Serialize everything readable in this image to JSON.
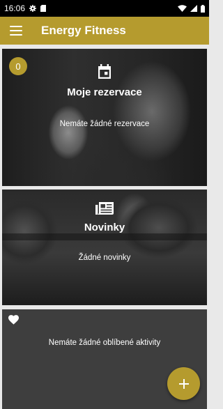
{
  "status_bar": {
    "time": "16:06",
    "left_icons": [
      "settings-icon",
      "sim-card-icon"
    ],
    "right_icons": [
      "wifi-icon",
      "cell-signal-icon",
      "battery-icon"
    ]
  },
  "app_bar": {
    "title": "Energy Fitness",
    "menu_icon": "hamburger-menu-icon",
    "color": "#b59b2e"
  },
  "cards": {
    "reservations": {
      "badge_count": "0",
      "icon": "calendar-icon",
      "title": "Moje rezervace",
      "subtitle": "Nemáte žádné rezervace"
    },
    "news": {
      "icon": "newspaper-icon",
      "title": "Novinky",
      "subtitle": "Žádné novinky"
    },
    "favorites": {
      "icon": "heart-icon",
      "text": "Nemáte žádné oblíbené aktivity"
    }
  },
  "fab": {
    "icon": "plus-icon",
    "color": "#b59b2e"
  }
}
